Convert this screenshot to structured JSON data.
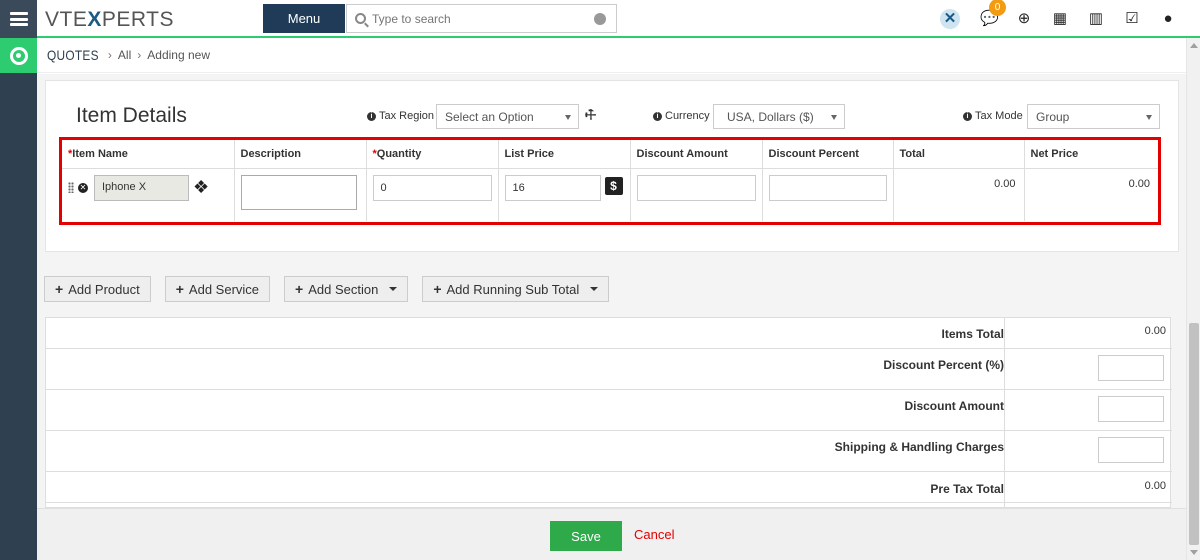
{
  "logo": {
    "pre": "VTE",
    "x": "X",
    "post": "PERTS"
  },
  "topbar": {
    "menu_label": "Menu",
    "search_placeholder": "Type to search",
    "notification_count": "0"
  },
  "breadcrumb": {
    "module": "QUOTES",
    "all": "All",
    "current": "Adding new"
  },
  "item_details": {
    "title": "Item Details",
    "tax_region_label": "Tax Region",
    "tax_region_value": "Select an Option",
    "currency_label": "Currency",
    "currency_value": "USA, Dollars ($)",
    "tax_mode_label": "Tax Mode",
    "tax_mode_value": "Group",
    "columns": [
      "Item Name",
      "Description",
      "Quantity",
      "List Price",
      "Discount Amount",
      "Discount Percent",
      "Total",
      "Net Price"
    ],
    "row": {
      "item_name": "Iphone X",
      "quantity": "0",
      "list_price": "16",
      "total": "0.00",
      "net_price": "0.00"
    }
  },
  "buttons": {
    "add_product": "Add Product",
    "add_service": "Add Service",
    "add_section": "Add Section",
    "add_running_sub_total": "Add Running Sub Total"
  },
  "totals": {
    "items_total_label": "Items Total",
    "items_total_value": "0.00",
    "discount_percent_label": "Discount Percent (%)",
    "discount_amount_label": "Discount Amount",
    "shipping_label": "Shipping & Handling Charges",
    "pre_tax_total_label": "Pre Tax Total",
    "pre_tax_total_value": "0.00"
  },
  "footer": {
    "save": "Save",
    "cancel": "Cancel"
  },
  "colors": {
    "accent_green": "#2ecc71",
    "highlight_red": "#e30000",
    "save_green": "#2eaa4a",
    "rail": "#2f4050"
  }
}
